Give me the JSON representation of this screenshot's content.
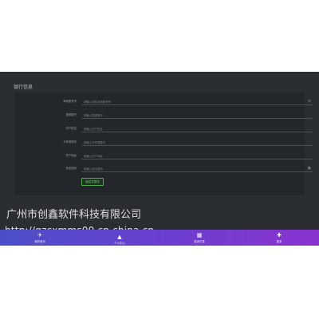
{
  "page": {
    "title": "银行信息"
  },
  "form": {
    "fields": [
      {
        "label": "本地账号号",
        "placeholder": "请输入你的本地账号号",
        "icon": "list-icon"
      },
      {
        "label": "提现银行",
        "placeholder": "请输入提现银行",
        "icon": ""
      },
      {
        "label": "开户姓名",
        "placeholder": "请输入开户姓名",
        "icon": ""
      },
      {
        "label": "卡号或账号",
        "placeholder": "请输入卡号或账号",
        "icon": ""
      },
      {
        "label": "开户地址",
        "placeholder": "请输入开户地址",
        "icon": ""
      },
      {
        "label": "安全密码",
        "placeholder": "请输入安全密码",
        "icon": "eye-icon"
      }
    ],
    "submit_label": "保存并提交"
  },
  "watermark": {
    "line1": "广州市创鑫软件科技有限公司",
    "line2": "http://gzcxmms00.cn.china.cn"
  },
  "tabbar": {
    "items": [
      {
        "label": "我的首页",
        "icon": "rocket-icon"
      },
      {
        "label": "个人中心",
        "icon": "user-icon"
      },
      {
        "label": "投资记录",
        "icon": "calendar-icon"
      },
      {
        "label": "更多",
        "icon": "plus-icon"
      }
    ]
  },
  "colors": {
    "background": "#2a2d31",
    "card": "#23262a",
    "accent_green": "#4cae4c",
    "tab_gradient_start": "#4a4fc9",
    "tab_gradient_end": "#8a33cf"
  }
}
